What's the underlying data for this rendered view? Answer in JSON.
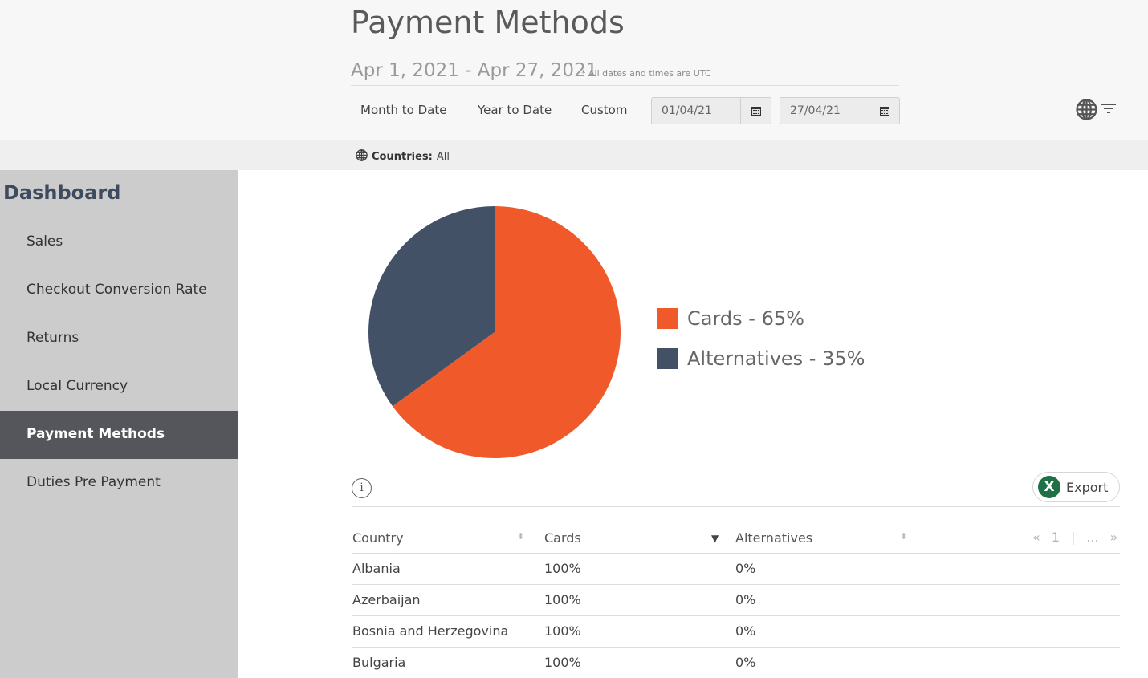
{
  "header": {
    "title": "Payment Methods",
    "date_range": "Apr 1, 2021 - Apr 27, 2021",
    "date_note": "* All dates and times are UTC",
    "range_buttons": [
      "Month to Date",
      "Year to Date",
      "Custom"
    ],
    "start_date": "01/04/21",
    "end_date": "27/04/21"
  },
  "filters": {
    "countries_label": "Countries:",
    "countries_value": "All"
  },
  "sidebar": {
    "title": "Dashboard",
    "items": [
      {
        "label": "Sales",
        "active": false
      },
      {
        "label": "Checkout Conversion Rate",
        "active": false
      },
      {
        "label": "Returns",
        "active": false
      },
      {
        "label": "Local Currency",
        "active": false
      },
      {
        "label": "Payment Methods",
        "active": true
      },
      {
        "label": "Duties Pre Payment",
        "active": false
      }
    ]
  },
  "chart_data": {
    "type": "pie",
    "title": "",
    "slices": [
      {
        "label": "Cards",
        "value": 65,
        "color": "#f05a2a"
      },
      {
        "label": "Alternatives",
        "value": 35,
        "color": "#435166"
      }
    ],
    "legend": [
      "Cards - 65%",
      "Alternatives - 35%"
    ],
    "legend_position": "right"
  },
  "table": {
    "export_label": "Export",
    "info_glyph": "i",
    "columns": [
      "Country",
      "Cards",
      "Alternatives"
    ],
    "sorted_column": "Cards",
    "pager": {
      "first": "«",
      "page": "1",
      "sep": "|",
      "more": "...",
      "last": "»"
    },
    "rows": [
      [
        "Albania",
        "100%",
        "0%"
      ],
      [
        "Azerbaijan",
        "100%",
        "0%"
      ],
      [
        "Bosnia and Herzegovina",
        "100%",
        "0%"
      ],
      [
        "Bulgaria",
        "100%",
        "0%"
      ]
    ]
  }
}
